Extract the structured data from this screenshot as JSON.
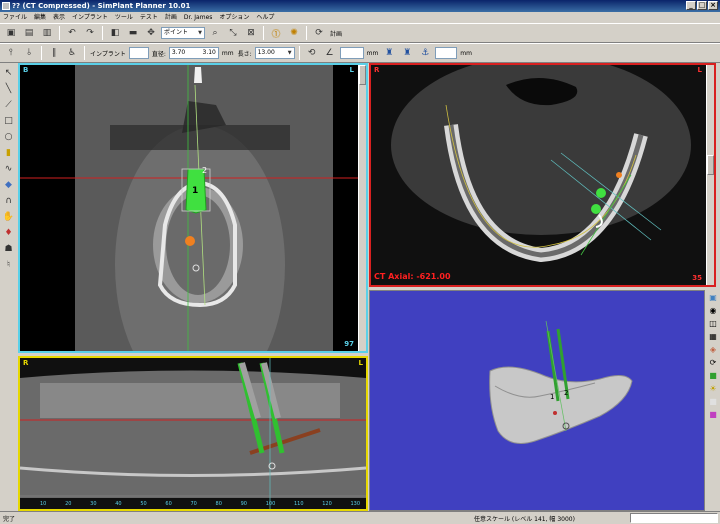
{
  "window": {
    "title": "?? (CT Compressed) - SimPlant Planner 10.01",
    "controls": [
      "_",
      "□",
      "×"
    ]
  },
  "menu": [
    "ファイル",
    "編集",
    "表示",
    "インプラント",
    "ツール",
    "テスト",
    "計画",
    "Dr. James",
    "オプション",
    "ヘルプ"
  ],
  "toolbar1": {
    "plan_label": "計画",
    "dropdown_value": "ポイント"
  },
  "toolbar2": {
    "implant_label": "インプラント",
    "diameter_label": "直径:",
    "diameter_value": "3.70",
    "diameter_alt": "3.10",
    "unit1": "mm",
    "length_label": "長さ:",
    "length_value": "13.00",
    "unit2": "mm",
    "unit3": "mm"
  },
  "views": {
    "coronal": {
      "left_marker": "B",
      "right_marker": "L",
      "slice": "97",
      "implant_numbers": [
        "1",
        "2"
      ]
    },
    "axial": {
      "left_marker": "R",
      "right_marker": "L",
      "label": "CT Axial: -621.00",
      "slice": "35"
    },
    "panoramic": {
      "left_marker": "R",
      "right_marker": "L",
      "scale": [
        "10",
        "20",
        "30",
        "40",
        "50",
        "60",
        "70",
        "80",
        "90",
        "100",
        "110",
        "120",
        "130"
      ]
    },
    "three_d": {
      "implant_numbers": [
        "1",
        "2"
      ]
    }
  },
  "status": {
    "left": "完了",
    "right": "任意スケール (レベル 141, 幅 3000)"
  },
  "colors": {
    "coronal_border": "#5ad0e8",
    "axial_border": "#d82020",
    "pano_border": "#e6d800",
    "three_d_bg": "#4040c0",
    "implant_green": "#40e040"
  },
  "icons": {
    "palette": [
      "pointer-icon",
      "line-icon",
      "polyline-icon",
      "rectangle-icon",
      "circle-icon",
      "label-icon",
      "curve-icon",
      "nerve-icon",
      "cube-icon",
      "arch-icon",
      "hand-icon",
      "sinus-icon",
      "tooth-icon"
    ]
  }
}
